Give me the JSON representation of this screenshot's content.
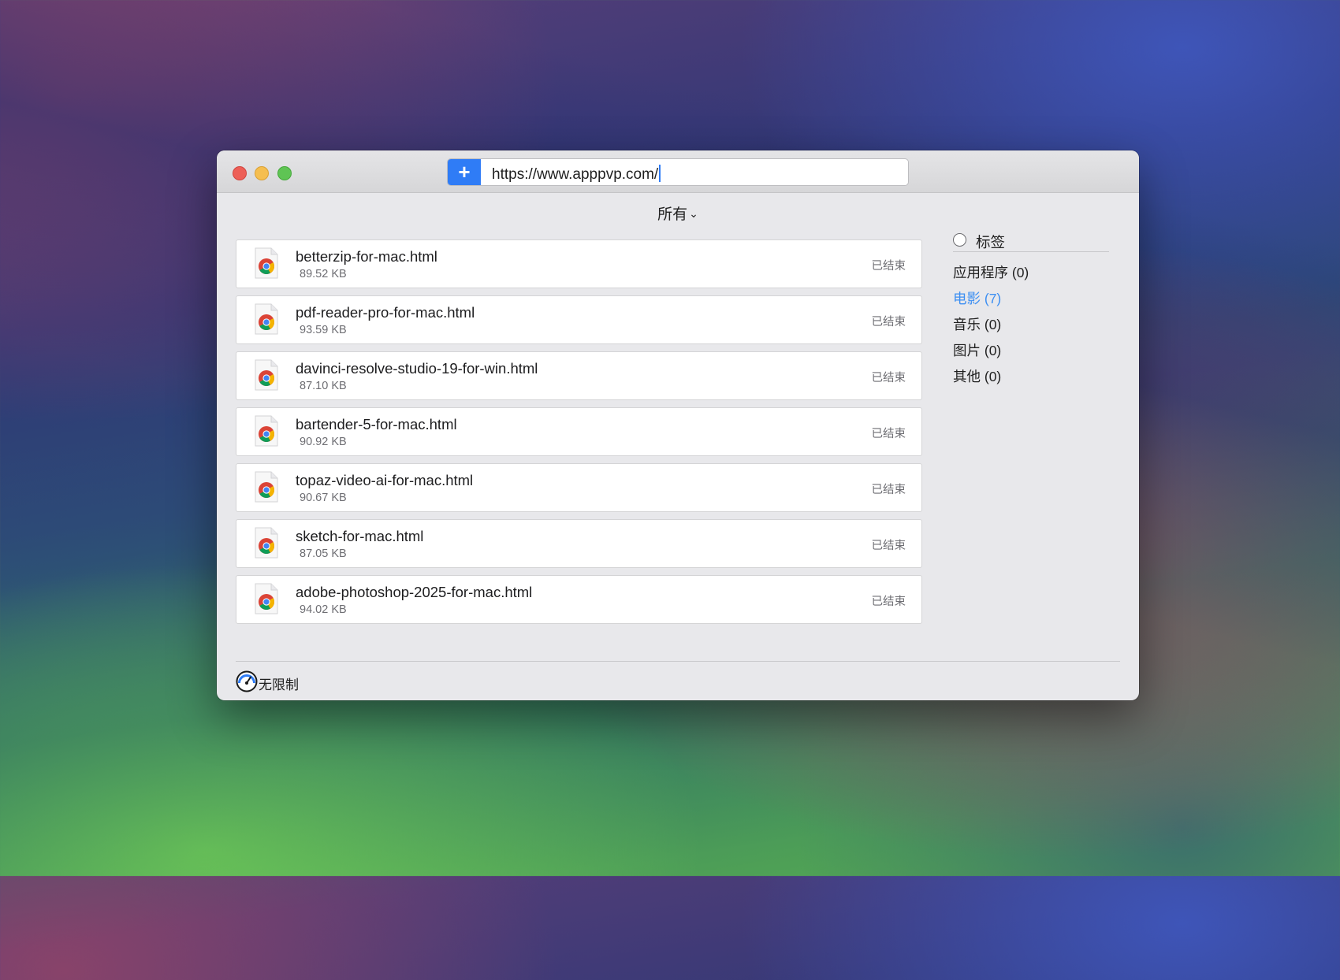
{
  "toolbar": {
    "add_icon": "plus-icon",
    "url_value": "https://www.apppvp.com/"
  },
  "filter": {
    "label": "所有",
    "icon": "chevron-down-icon"
  },
  "downloads": [
    {
      "name": "betterzip-for-mac.html",
      "size": "89.52 KB",
      "status": "已结束"
    },
    {
      "name": "pdf-reader-pro-for-mac.html",
      "size": "93.59 KB",
      "status": "已结束"
    },
    {
      "name": "davinci-resolve-studio-19-for-win.html",
      "size": "87.10 KB",
      "status": "已结束"
    },
    {
      "name": "bartender-5-for-mac.html",
      "size": "90.92 KB",
      "status": "已结束"
    },
    {
      "name": "topaz-video-ai-for-mac.html",
      "size": "90.67 KB",
      "status": "已结束"
    },
    {
      "name": "sketch-for-mac.html",
      "size": "87.05 KB",
      "status": "已结束"
    },
    {
      "name": "adobe-photoshop-2025-for-mac.html",
      "size": "94.02 KB",
      "status": "已结束"
    }
  ],
  "sidebar": {
    "tags_label": "标签",
    "categories": [
      {
        "label": "应用程序 (0)",
        "active": false
      },
      {
        "label": "电影 (7)",
        "active": true
      },
      {
        "label": "音乐 (0)",
        "active": false
      },
      {
        "label": "图片 (0)",
        "active": false
      },
      {
        "label": "其他 (0)",
        "active": false
      }
    ]
  },
  "footer": {
    "speed_label": "无限制",
    "speed_icon": "speedometer-icon"
  },
  "colors": {
    "accent": "#2f7cf6",
    "active_category": "#3d8ff2"
  }
}
